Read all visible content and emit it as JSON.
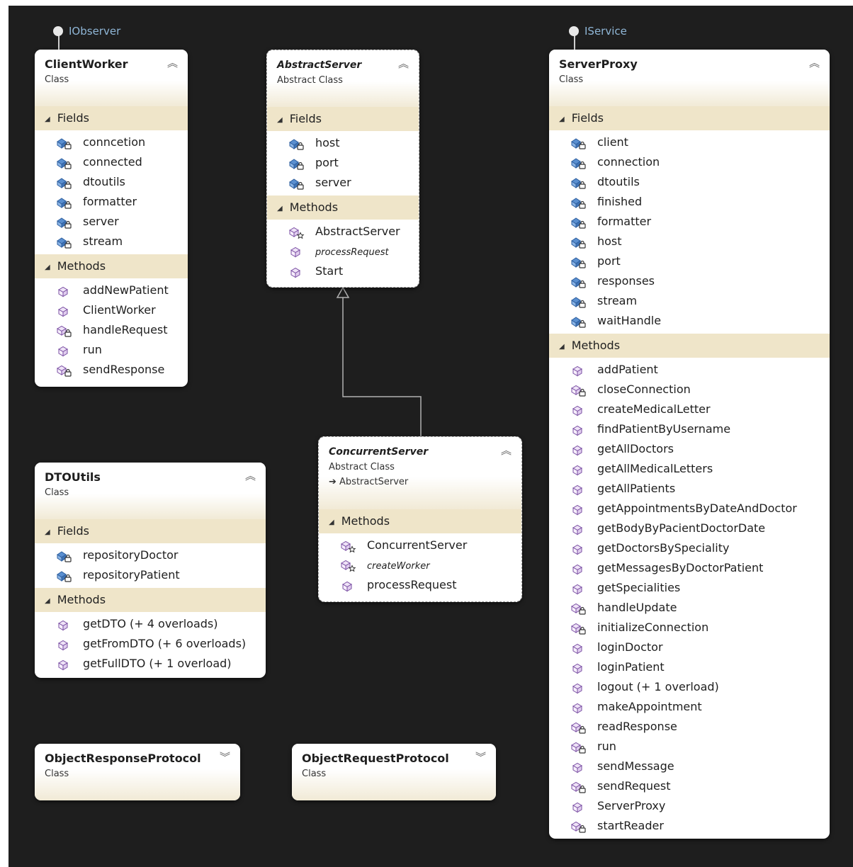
{
  "interfaces": [
    {
      "id": "iobserver",
      "name": "IObserver"
    },
    {
      "id": "iservice",
      "name": "IService"
    }
  ],
  "classes": {
    "clientWorker": {
      "name": "ClientWorker",
      "stereotype": "Class",
      "fields_label": "Fields",
      "methods_label": "Methods",
      "fields": [
        "conncetion",
        "connected",
        "dtoutils",
        "formatter",
        "server",
        "stream"
      ],
      "methods": [
        {
          "name": "addNewPatient",
          "icon": "method-public-icon"
        },
        {
          "name": "ClientWorker",
          "icon": "method-public-icon"
        },
        {
          "name": "handleRequest",
          "icon": "method-private-icon"
        },
        {
          "name": "run",
          "icon": "method-public-icon"
        },
        {
          "name": "sendResponse",
          "icon": "method-private-icon"
        }
      ]
    },
    "abstractServer": {
      "name": "AbstractServer",
      "stereotype": "Abstract Class",
      "fields_label": "Fields",
      "methods_label": "Methods",
      "fields": [
        "host",
        "port",
        "server"
      ],
      "methods": [
        {
          "name": "AbstractServer",
          "icon": "method-protected-icon"
        },
        {
          "name": "processRequest",
          "icon": "method-public-icon",
          "italic": true
        },
        {
          "name": "Start",
          "icon": "method-public-icon"
        }
      ]
    },
    "concurrentServer": {
      "name": "ConcurrentServer",
      "stereotype": "Abstract Class",
      "base": "AbstractServer",
      "methods_label": "Methods",
      "methods": [
        {
          "name": "ConcurrentServer",
          "icon": "method-protected-icon"
        },
        {
          "name": "createWorker",
          "icon": "method-protected-icon",
          "italic": true
        },
        {
          "name": "processRequest",
          "icon": "method-public-icon"
        }
      ]
    },
    "dtoUtils": {
      "name": "DTOUtils",
      "stereotype": "Class",
      "fields_label": "Fields",
      "methods_label": "Methods",
      "fields": [
        "repositoryDoctor",
        "repositoryPatient"
      ],
      "methods": [
        {
          "name": "getDTO (+ 4 overloads)",
          "icon": "method-public-icon"
        },
        {
          "name": "getFromDTO (+ 6 overloads)",
          "icon": "method-public-icon"
        },
        {
          "name": "getFullDTO (+ 1 overload)",
          "icon": "method-public-icon"
        }
      ]
    },
    "objectResponseProtocol": {
      "name": "ObjectResponseProtocol",
      "stereotype": "Class"
    },
    "objectRequestProtocol": {
      "name": "ObjectRequestProtocol",
      "stereotype": "Class"
    },
    "serverProxy": {
      "name": "ServerProxy",
      "stereotype": "Class",
      "fields_label": "Fields",
      "methods_label": "Methods",
      "fields": [
        "client",
        "connection",
        "dtoutils",
        "finished",
        "formatter",
        "host",
        "port",
        "responses",
        "stream",
        "waitHandle"
      ],
      "methods": [
        {
          "name": "addPatient",
          "icon": "method-public-icon"
        },
        {
          "name": "closeConnection",
          "icon": "method-private-icon"
        },
        {
          "name": "createMedicalLetter",
          "icon": "method-public-icon"
        },
        {
          "name": "findPatientByUsername",
          "icon": "method-public-icon"
        },
        {
          "name": "getAllDoctors",
          "icon": "method-public-icon"
        },
        {
          "name": "getAllMedicalLetters",
          "icon": "method-public-icon"
        },
        {
          "name": "getAllPatients",
          "icon": "method-public-icon"
        },
        {
          "name": "getAppointmentsByDateAndDoctor",
          "icon": "method-public-icon"
        },
        {
          "name": "getBodyByPacientDoctorDate",
          "icon": "method-public-icon"
        },
        {
          "name": "getDoctorsBySpeciality",
          "icon": "method-public-icon"
        },
        {
          "name": "getMessagesByDoctorPatient",
          "icon": "method-public-icon"
        },
        {
          "name": "getSpecialities",
          "icon": "method-public-icon"
        },
        {
          "name": "handleUpdate",
          "icon": "method-private-icon"
        },
        {
          "name": "initializeConnection",
          "icon": "method-private-icon"
        },
        {
          "name": "loginDoctor",
          "icon": "method-public-icon"
        },
        {
          "name": "loginPatient",
          "icon": "method-public-icon"
        },
        {
          "name": "logout (+ 1 overload)",
          "icon": "method-public-icon"
        },
        {
          "name": "makeAppointment",
          "icon": "method-public-icon"
        },
        {
          "name": "readResponse",
          "icon": "method-private-icon"
        },
        {
          "name": "run",
          "icon": "method-private-icon"
        },
        {
          "name": "sendMessage",
          "icon": "method-public-icon"
        },
        {
          "name": "sendRequest",
          "icon": "method-private-icon"
        },
        {
          "name": "ServerProxy",
          "icon": "method-public-icon"
        },
        {
          "name": "startReader",
          "icon": "method-private-icon"
        }
      ]
    }
  }
}
